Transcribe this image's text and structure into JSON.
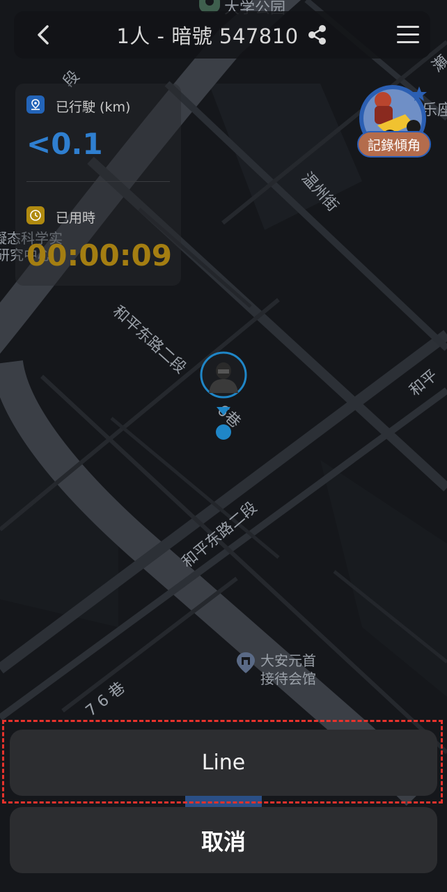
{
  "header": {
    "title": "1人 - 暗號 547810"
  },
  "stats": {
    "distance_label": "已行駛 (km)",
    "distance_value": "<0.1",
    "time_label": "已用時",
    "time_value": "00:00:09"
  },
  "map": {
    "labels": {
      "park": "大学公园",
      "wenzhou_st": "温州街",
      "heping_e_rd_top": "和平东路二段",
      "lane_suffix": "6巷",
      "heping_e_rd_mid": "和平东路二段",
      "heping_right": "和平",
      "duan": "段",
      "research_1": "凝态科学实",
      "research_2": "研究中心",
      "daan_1": "大安元首",
      "daan_2": "接待会馆",
      "lane_76": "7 6 巷",
      "right_edge_1": "乐座",
      "right_edge_2": "瀬"
    }
  },
  "lean_angle_button": "記錄傾角",
  "action_sheet": {
    "line_label": "Line",
    "cancel_label": "取消"
  },
  "colors": {
    "distance_accent": "#2f7fd0",
    "time_accent": "#a47e12",
    "highlight": "#e8322c",
    "rider_marker": "#1f86c7"
  }
}
